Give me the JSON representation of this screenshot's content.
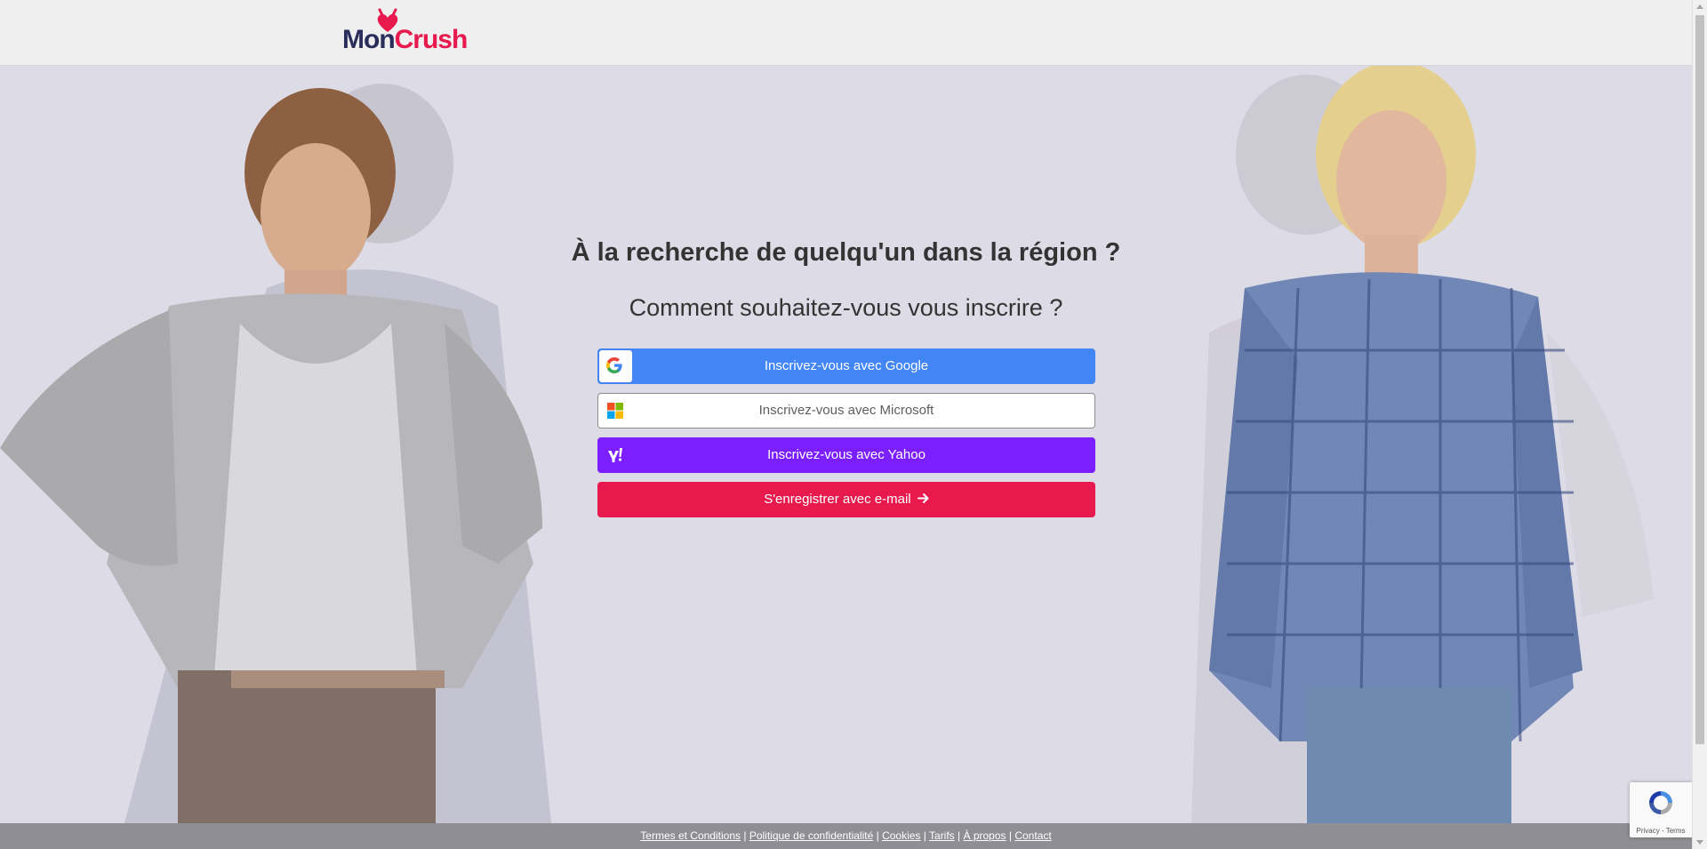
{
  "header": {
    "logo_mon": "Mon",
    "logo_crush": "Crush"
  },
  "main": {
    "headline": "À la recherche de quelqu'un dans la région ?",
    "subheadline": "Comment souhaitez-vous vous inscrire ?",
    "buttons": {
      "google": "Inscrivez-vous avec Google",
      "microsoft": "Inscrivez-vous avec Microsoft",
      "yahoo": "Inscrivez-vous avec Yahoo",
      "email": "S'enregistrer avec e-mail"
    }
  },
  "footer": {
    "links": [
      "Termes et Conditions",
      "Politique de confidentialité",
      "Cookies",
      "Tarifs",
      "À propos",
      "Contact"
    ],
    "separator": "|"
  },
  "recaptcha": {
    "privacy": "Privacy",
    "dash": "-",
    "terms": "Terms"
  },
  "colors": {
    "brand_pink": "#e8194d",
    "brand_navy": "#2a2d5a",
    "google_blue": "#4285f4",
    "yahoo_purple": "#7b1fff",
    "background": "#dddbe6"
  },
  "icons": {
    "logo": "heart-devil-icon",
    "google": "google-g-icon",
    "microsoft": "microsoft-logo-icon",
    "yahoo": "yahoo-y-icon",
    "email_arrow": "arrow-right-icon",
    "recaptcha": "recaptcha-icon"
  }
}
